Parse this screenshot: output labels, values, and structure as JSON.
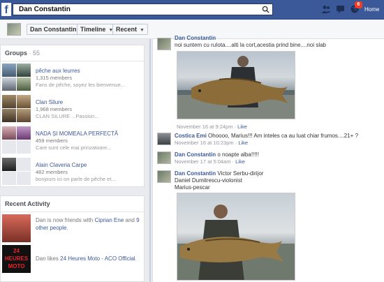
{
  "search": {
    "value": "Dan Constantin"
  },
  "topbar": {
    "notification_count": "6",
    "home_label": "Home"
  },
  "header": {
    "name_button": "Dan Constantin",
    "timeline_button": "Timeline",
    "recent_button": "Recent"
  },
  "groups": {
    "title": "Groups",
    "count": " · 55",
    "items": [
      {
        "name": "pêche aux leurres",
        "members": "1,315 members",
        "desc": "Fans de pêche, soyez les bienvenue..."
      },
      {
        "name": "Clan Silure",
        "members": "1,968 members",
        "desc": "CLAN SILURE ...Passion..."
      },
      {
        "name": "NADA ȘI MOMEALA PERFECTĂ",
        "members": "459 members",
        "desc": "Care sunt cele mai prinzatoare..."
      },
      {
        "name": "Alain Claveria Carpe",
        "members": "482 members",
        "desc": "bonjours ici on parle de pêche et..."
      }
    ]
  },
  "recent_activity": {
    "title": "Recent Activity",
    "items": [
      {
        "pre": "Dan is now friends with ",
        "link1": "Ciprian Ene",
        "mid": " and ",
        "link2": "9 other people",
        "post": "."
      },
      {
        "pre": "Dan likes ",
        "link1": "24 Heures Moto - ACO Official",
        "post": "."
      }
    ],
    "logo_text": "24 HEURES MOTO"
  },
  "feed": {
    "top_partial": {
      "author": "Dan Constantin",
      "text": "noi suntem cu ruIota....alti la cort,acestia prind bine....noi slab"
    },
    "photo1_time": "November 16 at 9:24pm",
    "comments": [
      {
        "author": "Costica Emi",
        "text": "Ohoooo, Marius!!! Am inteles ca au luat chiar frumos....21+ ?",
        "time": "November 16 at 10:23pm",
        "like": "Like"
      },
      {
        "author": "Dan Constantin",
        "text": "o noapte alba!!!!!",
        "time": "November 17 at 5:04am",
        "like": "Like"
      },
      {
        "author": "Dan Constantin",
        "text": "Victor Serbu-dirijor",
        "line2": "Daniel Dumitrescu-violonist",
        "line3": "Marius-pescar"
      }
    ],
    "like_label": "Like"
  }
}
